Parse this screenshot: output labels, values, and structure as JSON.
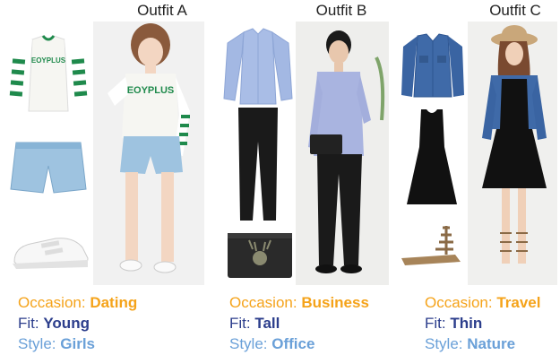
{
  "outfits": [
    {
      "title": "Outfit A",
      "occasion_label": "Occasion:",
      "occasion": "Dating",
      "fit_label": "Fit:",
      "fit": "Young",
      "style_label": "Style:",
      "style": "Girls",
      "shirt_print": "EOYPLUS",
      "items": [
        "striped-sleeve-tshirt-icon",
        "denim-shorts-icon",
        "white-sneakers-icon"
      ]
    },
    {
      "title": "Outfit B",
      "occasion_label": "Occasion:",
      "occasion": "Business",
      "fit_label": "Fit:",
      "fit": "Tall",
      "style_label": "Style:",
      "style": "Office",
      "items": [
        "blue-dress-shirt-icon",
        "black-trousers-icon",
        "deer-clutch-icon"
      ]
    },
    {
      "title": "Outfit C",
      "occasion_label": "Occasion:",
      "occasion": "Travel",
      "fit_label": "Fit:",
      "fit": "Thin",
      "style_label": "Style:",
      "style": "Nature",
      "items": [
        "denim-jacket-icon",
        "black-dress-icon",
        "gladiator-sandals-icon"
      ]
    }
  ],
  "colors": {
    "occasion": "#f5a31a",
    "fit": "#2c3e8c",
    "style": "#6aa0d8"
  }
}
